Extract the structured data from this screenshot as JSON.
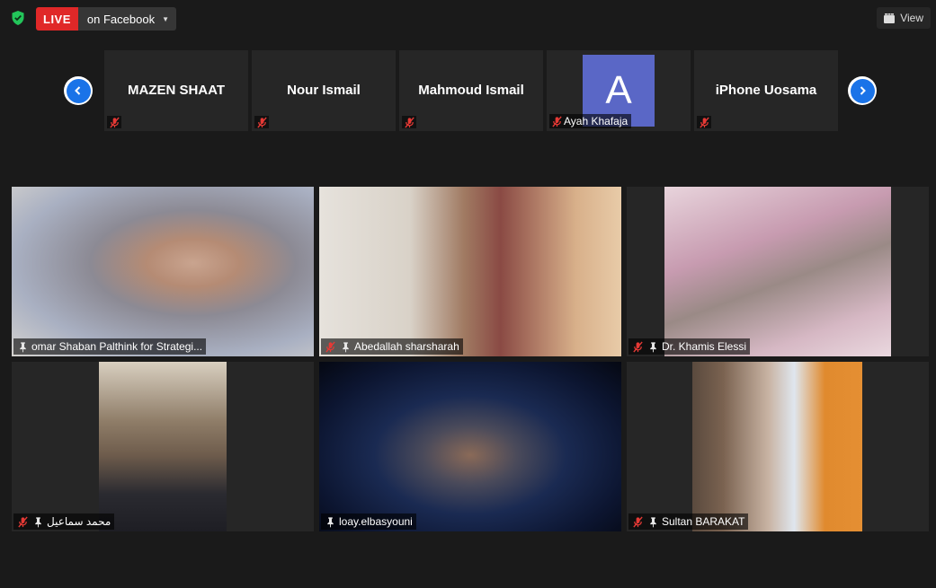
{
  "topbar": {
    "live_label": "LIVE",
    "destination": "on Facebook",
    "view_label": "View"
  },
  "strip": {
    "participants": [
      {
        "name": "MAZEN SHAAT",
        "muted": true
      },
      {
        "name": "Nour Ismail",
        "muted": true
      },
      {
        "name": "Mahmoud Ismail",
        "muted": true
      },
      {
        "name": "Ayah Khafaja",
        "avatar_letter": "A",
        "muted": true
      },
      {
        "name": "iPhone Uosama",
        "muted": true
      }
    ]
  },
  "gallery": [
    {
      "name": "omar Shaban Palthink for Strategi...",
      "muted": false,
      "pinned": true
    },
    {
      "name": "Abedallah sharsharah",
      "muted": true,
      "pinned": true
    },
    {
      "name": "Dr. Khamis Elessi",
      "muted": true,
      "pinned": true
    },
    {
      "name": "محمد سماعيل",
      "muted": true,
      "pinned": true
    },
    {
      "name": "loay.elbasyouni",
      "muted": false,
      "pinned": true
    },
    {
      "name": "Sultan BARAKAT",
      "muted": true,
      "pinned": true
    }
  ],
  "colors": {
    "background": "#1a1a1a",
    "tile": "#262626",
    "live_red": "#e02828",
    "nav_blue": "#1a73e8",
    "avatar_purple": "#5a67c6",
    "security_green": "#23c55a"
  },
  "icons": [
    "security-shield-icon",
    "dropdown-caret-icon",
    "view-grid-icon",
    "muted-mic-icon",
    "pin-icon",
    "chevron-left-icon",
    "chevron-right-icon"
  ]
}
